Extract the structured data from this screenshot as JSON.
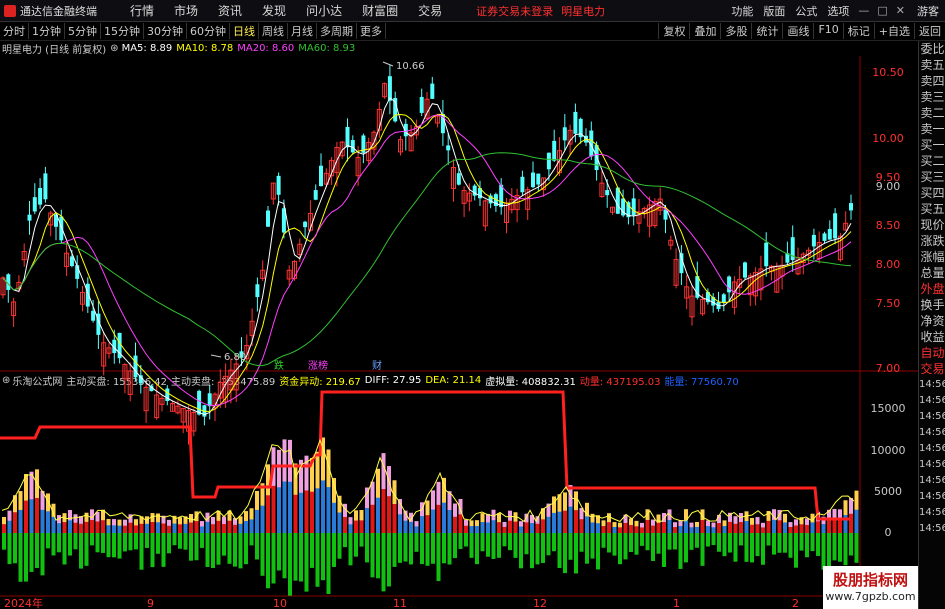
{
  "app": {
    "title": "通达信金融终端"
  },
  "menu": [
    "行情",
    "市场",
    "资讯",
    "发现",
    "问小达",
    "财富圈",
    "交易"
  ],
  "warning": "证券交易未登录",
  "stock_name": "明星电力",
  "top_right": [
    "功能",
    "版面",
    "公式",
    "选项"
  ],
  "window_controls": [
    "—",
    "□",
    "✕"
  ],
  "guest": "游客",
  "timeframes": [
    "分时",
    "1分钟",
    "5分钟",
    "15分钟",
    "30分钟",
    "60分钟",
    "日线",
    "周线",
    "月线",
    "多周期",
    "更多"
  ],
  "active_timeframe": "日线",
  "tools": [
    "复权",
    "叠加",
    "多股",
    "统计",
    "画线",
    "F10",
    "标记",
    "+自选",
    "返回"
  ],
  "upper_legend": {
    "title": "明星电力 (日线 前复权)",
    "ma5": "MA5: 8.89",
    "ma10": "MA10: 8.78",
    "ma20": "MA20: 8.60",
    "ma60": "MA60: 8.93"
  },
  "lower_legend": {
    "name": "乐淘公式网",
    "buy": "主动买盘: 155356.42",
    "sell": "主动卖盘: -253475.89",
    "flow": "资金异动: 219.67",
    "diff": "DIFF: 27.95",
    "dea": "DEA: 21.14",
    "virtual": "虚拟量: 408832.31",
    "dynamic": "动量: 437195.03",
    "energy": "能量: 77560.70"
  },
  "price_axis": [
    "10.50",
    "10.00",
    "9.50",
    "9.00",
    "8.50",
    "8.00",
    "7.50",
    "7.00"
  ],
  "vol_axis": [
    "15000",
    "10000",
    "5000",
    "0"
  ],
  "date_labels": [
    "2024年",
    "9",
    "10",
    "11",
    "12",
    "1",
    "2"
  ],
  "annotations": {
    "high": "10.66",
    "low": "6.80",
    "tag1": "跌",
    "tag2": "涨榜",
    "tag3": "财"
  },
  "sidebar": [
    "委比",
    "卖五",
    "卖四",
    "卖三",
    "卖二",
    "卖一",
    "买一",
    "买二",
    "买三",
    "买四",
    "买五",
    "现价",
    "涨跌",
    "涨幅",
    "总量",
    "外盘",
    "换手",
    "净资",
    "收益",
    "自动",
    "交易"
  ],
  "times": [
    "14:56",
    "14:56",
    "14:56",
    "14:56",
    "14:56",
    "14:56",
    "14:56",
    "14:56",
    "14:56",
    "14:56"
  ],
  "watermark": {
    "line1": "股朋指标网",
    "line2": "www.7gpzb.com"
  },
  "colors": {
    "up": "#ff3232",
    "down": "#54ffff",
    "ma5": "#ffffff",
    "ma10": "#ffff00",
    "ma20": "#ff40ff",
    "ma60": "#30c030"
  }
}
